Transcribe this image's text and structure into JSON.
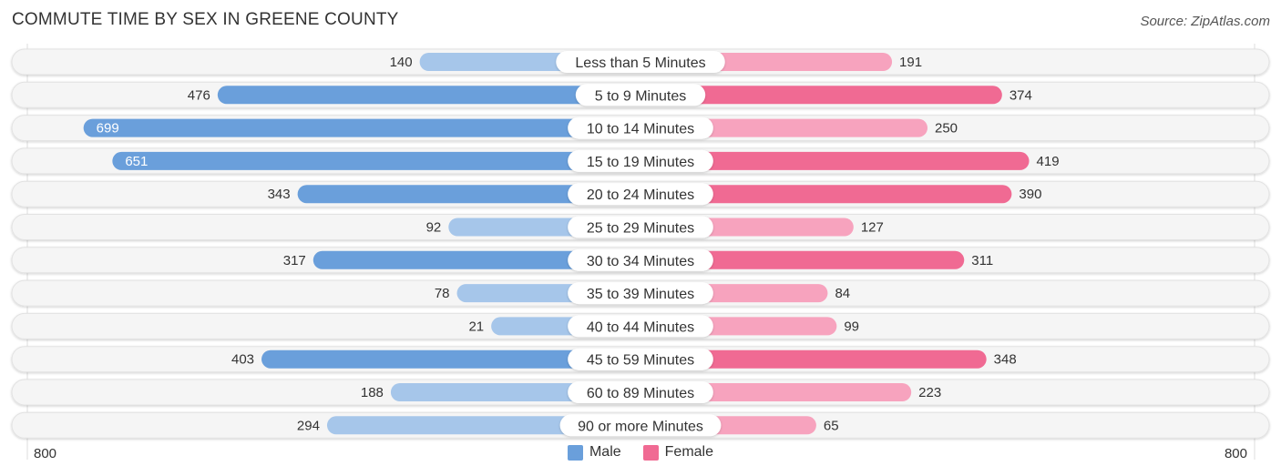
{
  "header": {
    "title": "COMMUTE TIME BY SEX IN GREENE COUNTY",
    "source": "Source: ZipAtlas.com"
  },
  "legend": {
    "male": "Male",
    "female": "Female"
  },
  "axis": {
    "left_label": "800",
    "right_label": "800"
  },
  "colors": {
    "male": "#6a9fdb",
    "male_light": "#a6c6ea",
    "female": "#f06a93",
    "female_light": "#f7a3be"
  },
  "chart_data": {
    "type": "bar",
    "title": "COMMUTE TIME BY SEX IN GREENE COUNTY",
    "orientation": "horizontal-diverging",
    "xlim": [
      -800,
      800
    ],
    "categories": [
      "Less than 5 Minutes",
      "5 to 9 Minutes",
      "10 to 14 Minutes",
      "15 to 19 Minutes",
      "20 to 24 Minutes",
      "25 to 29 Minutes",
      "30 to 34 Minutes",
      "35 to 39 Minutes",
      "40 to 44 Minutes",
      "45 to 59 Minutes",
      "60 to 89 Minutes",
      "90 or more Minutes"
    ],
    "series": [
      {
        "name": "Male",
        "values": [
          140,
          476,
          699,
          651,
          343,
          92,
          317,
          78,
          21,
          403,
          188,
          294
        ]
      },
      {
        "name": "Female",
        "values": [
          191,
          374,
          250,
          419,
          390,
          127,
          311,
          84,
          99,
          348,
          223,
          65
        ]
      }
    ],
    "legend_position": "bottom-center"
  }
}
